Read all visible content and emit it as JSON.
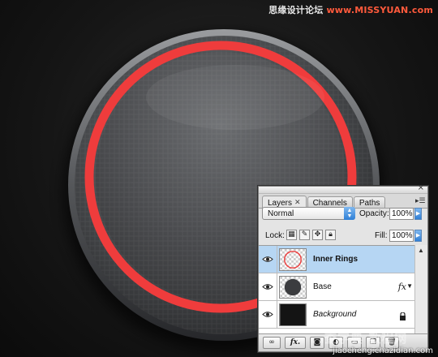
{
  "watermark": {
    "top_prefix": "思缘设计论坛",
    "top_site": "www.MISSYUAN.com",
    "bottom_logo": "查字典 教程网",
    "bottom_url": "jiaocheng.chazidian.com"
  },
  "colors": {
    "ring": "#ef3c3c",
    "selection": "#b6d6f3",
    "accent_blue": "#2f7fd6"
  },
  "layers_panel": {
    "tabs": [
      {
        "label": "Layers",
        "active": true,
        "closable": true
      },
      {
        "label": "Channels",
        "active": false
      },
      {
        "label": "Paths",
        "active": false
      }
    ],
    "blend_mode": "Normal",
    "opacity_label": "Opacity:",
    "opacity_value": "100%",
    "lock_label": "Lock:",
    "fill_label": "Fill:",
    "fill_value": "100%",
    "layers": [
      {
        "name": "Inner Rings",
        "selected": true,
        "style": "bold",
        "visible": true,
        "icon": "eye-icon"
      },
      {
        "name": "Base",
        "selected": false,
        "style": "normal",
        "visible": true,
        "has_fx": true,
        "fx_label": "fx",
        "icon": "eye-icon"
      },
      {
        "name": "Background",
        "selected": false,
        "style": "italic",
        "visible": true,
        "locked": true,
        "icon": "eye-icon"
      }
    ],
    "bottom_buttons": [
      {
        "icon": "link-layers-icon"
      },
      {
        "icon": "fx-icon",
        "label": "fx."
      },
      {
        "icon": "mask-icon"
      },
      {
        "icon": "adjustment-layer-icon"
      },
      {
        "icon": "group-folder-icon"
      },
      {
        "icon": "new-layer-icon"
      },
      {
        "icon": "trash-icon"
      }
    ]
  }
}
